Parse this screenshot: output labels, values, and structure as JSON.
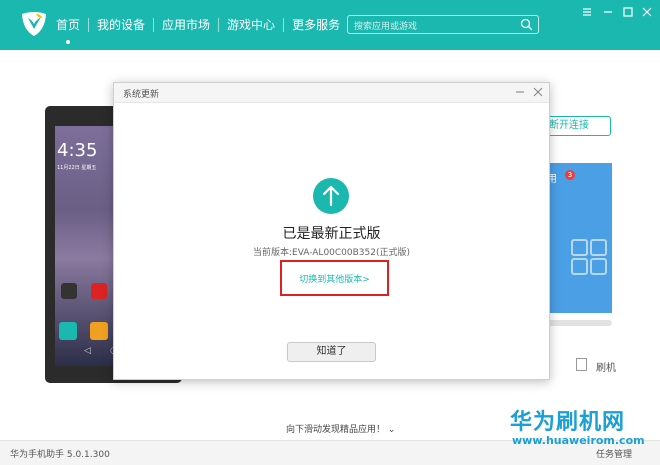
{
  "app": {
    "nav": [
      {
        "label": "首页",
        "active": true
      },
      {
        "label": "我的设备"
      },
      {
        "label": "应用市场"
      },
      {
        "label": "游戏中心"
      },
      {
        "label": "更多服务"
      }
    ],
    "search": {
      "placeholder": "搜索应用或游戏"
    },
    "accent_color": "#1bb8b0"
  },
  "background": {
    "phone_time": "4:35",
    "phone_date": "11月22日 星期五",
    "reconnect_label": "断开连接",
    "card_label": "用",
    "badge_count": "3",
    "flash_label": "刷机",
    "scroll_hint": "向下滑动发现精品应用！"
  },
  "dialog": {
    "title": "系统更新",
    "heading": "已是最新正式版",
    "current_version": "当前版本:EVA-AL00C00B352(正式版)",
    "switch_link": "切换到其他版本>",
    "ok_button": "知道了"
  },
  "statusbar": {
    "version": "华为手机助手 5.0.1.300",
    "tasks": "任务管理"
  },
  "watermark": {
    "title": "华为刷机网",
    "url": "www.huaweirom.com"
  }
}
